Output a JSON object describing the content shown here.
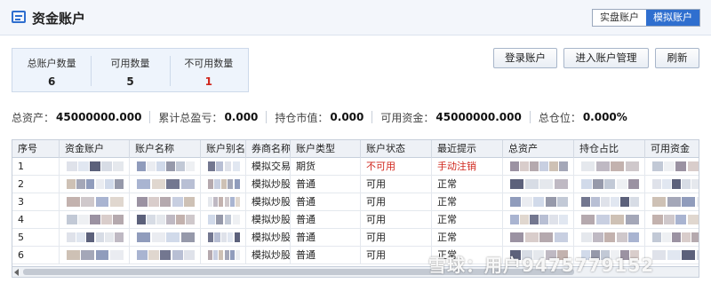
{
  "header": {
    "title": "资金账户",
    "modes": [
      {
        "label": "实盘账户",
        "active": false
      },
      {
        "label": "模拟账户",
        "active": true
      }
    ]
  },
  "stats": [
    {
      "label": "总账户数量",
      "value": "6"
    },
    {
      "label": "可用数量",
      "value": "5"
    },
    {
      "label": "不可用数量",
      "value": "1"
    }
  ],
  "actions": {
    "login": "登录账户",
    "manage": "进入账户管理",
    "refresh": "刷新"
  },
  "summary": [
    {
      "label": "总资产：",
      "value": "45000000.000"
    },
    {
      "label": "累计总盈亏：",
      "value": "0.000"
    },
    {
      "label": "持仓市值：",
      "value": "0.000"
    },
    {
      "label": "可用资金：",
      "value": "45000000.000"
    },
    {
      "label": "总仓位：",
      "value": "0.000%"
    }
  ],
  "table": {
    "columns": [
      "序号",
      "资金账户",
      "账户名称",
      "账户别名",
      "券商名称",
      "账户类型",
      "账户状态",
      "最近提示",
      "总资产",
      "持仓占比",
      "可用资金"
    ],
    "rows": [
      [
        "1",
        "",
        "",
        "",
        "模拟交易",
        "期货",
        "不可用",
        "手动注销"
      ],
      [
        "2",
        "",
        "",
        "",
        "模拟炒股",
        "普通",
        "可用",
        "正常"
      ],
      [
        "3",
        "",
        "",
        "",
        "模拟炒股",
        "普通",
        "可用",
        "正常"
      ],
      [
        "4",
        "",
        "",
        "",
        "模拟炒股",
        "普通",
        "可用",
        "正常"
      ],
      [
        "5",
        "",
        "",
        "",
        "模拟炒股",
        "普通",
        "可用",
        "正常"
      ],
      [
        "6",
        "",
        "",
        "",
        "模拟炒股",
        "普通",
        "可用",
        "正常"
      ]
    ]
  },
  "colors": {
    "accent": "#2f6fcf",
    "danger": "#d0271d"
  },
  "watermark": "雪球：用户9475779152"
}
